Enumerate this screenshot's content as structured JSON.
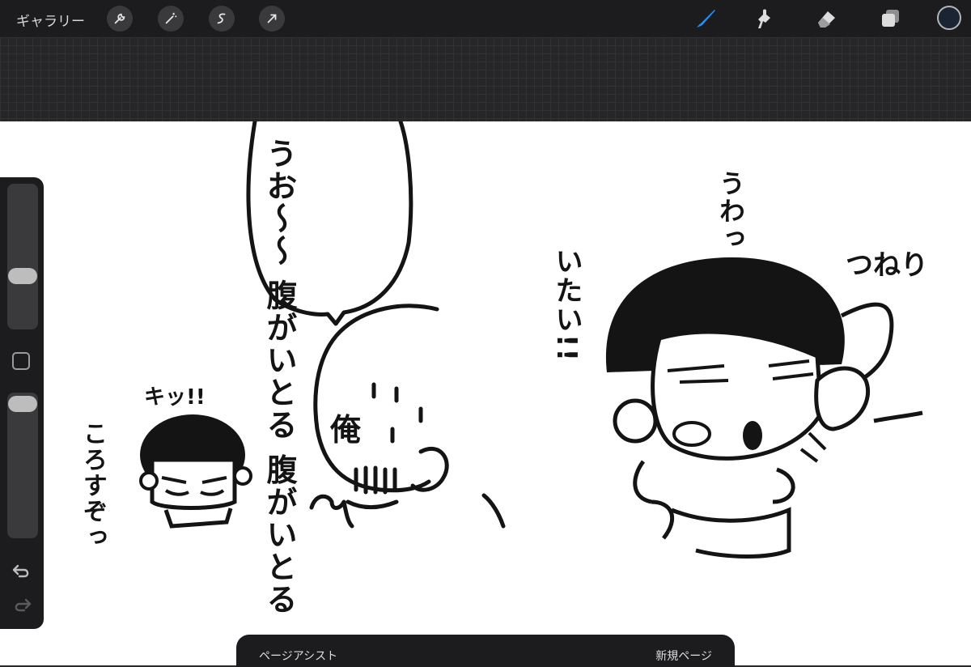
{
  "toolbar": {
    "gallery_label": "ギャラリー",
    "left_tools": [
      "wrench-icon",
      "magic-wand-icon",
      "selection-icon",
      "transform-arrow-icon"
    ],
    "right_tools": [
      "brush-icon",
      "smudge-icon",
      "eraser-icon",
      "layers-icon"
    ],
    "active_tool": "brush-icon",
    "accent_color": "#1e90ff",
    "current_color": "#1a2433"
  },
  "canvas": {
    "bubble_text_lines": [
      "うお〜〜",
      "腹がいとる",
      "腹がいとる"
    ],
    "bald_label": "俺",
    "kitt_text": "キッ!!",
    "korosuzo_text": "ころすぞっ",
    "uwa_text": "うわっ",
    "itai_text": "いたい!!",
    "tsuneri_text": "つねり"
  },
  "sidebar": {
    "brush_size_level": 0.45,
    "opacity_level": 0.04
  },
  "page_assist": {
    "title": "ページアシスト",
    "new_page_label": "新規ページ"
  }
}
